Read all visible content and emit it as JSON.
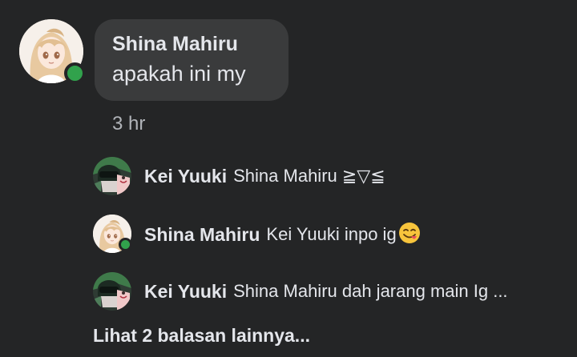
{
  "comment": {
    "author": "Shina Mahiru",
    "text": "apakah ini my",
    "time": "3 hr",
    "avatar_icon": "anime-girl-blonde-avatar",
    "online": true
  },
  "replies": [
    {
      "author": "Kei Yuuki",
      "text": "Shina Mahiru ≧▽≦",
      "avatar_icon": "anime-helmet-avatar",
      "online": false
    },
    {
      "author": "Shina Mahiru",
      "text": "Kei Yuuki inpo ig",
      "emoji": "savoring-food-emoji",
      "avatar_icon": "anime-girl-blonde-avatar",
      "online": true
    },
    {
      "author": "Kei Yuuki",
      "text": "Shina Mahiru dah jarang main Ig ...",
      "avatar_icon": "anime-helmet-avatar",
      "online": false
    }
  ],
  "more_replies_label": "Lihat 2 balasan lainnya...",
  "colors": {
    "background": "#242526",
    "bubble": "#3a3b3c",
    "text": "#e4e6eb",
    "secondary_text": "#b0b3b8",
    "online": "#31a24c"
  }
}
